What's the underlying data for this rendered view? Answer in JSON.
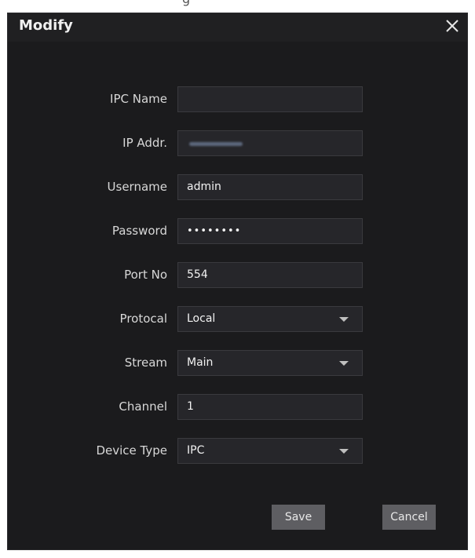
{
  "top_fragment": "g",
  "dialog": {
    "title": "Modify",
    "close_icon": "close-icon",
    "fields": [
      {
        "label": "IPC Name",
        "value": ""
      },
      {
        "label": "IP Addr.",
        "value": ""
      },
      {
        "label": "Username",
        "value": "admin"
      },
      {
        "label": "Password",
        "value": "••••••••"
      },
      {
        "label": "Port No",
        "value": "554"
      },
      {
        "label": "Protocal",
        "value": "Local"
      },
      {
        "label": "Stream",
        "value": "Main"
      },
      {
        "label": "Channel",
        "value": "1"
      },
      {
        "label": "Device Type",
        "value": "IPC"
      }
    ],
    "buttons": {
      "save": "Save",
      "cancel": "Cancel"
    }
  },
  "colors": {
    "dialog_bg": "#1b1b1d",
    "field_bg": "#26262a",
    "button_bg": "#5e5e62"
  }
}
